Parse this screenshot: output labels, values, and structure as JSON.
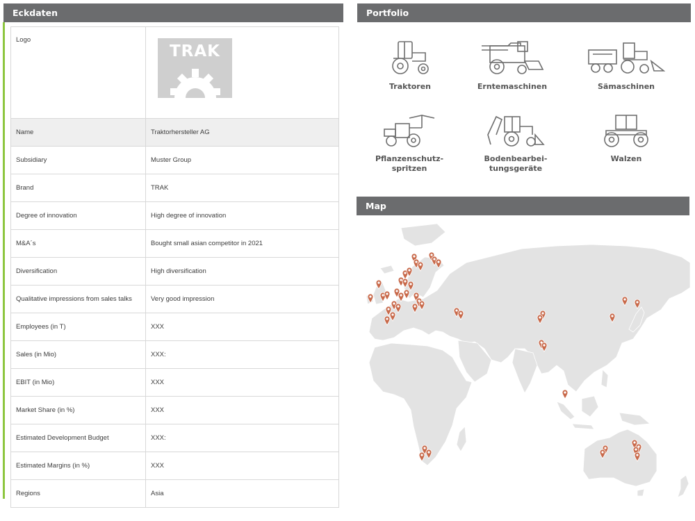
{
  "eckdaten": {
    "header": "Eckdaten",
    "logo_label": "Logo",
    "logo_text": "TRAK",
    "rows": [
      {
        "label": "Name",
        "value": "Traktorhersteller AG"
      },
      {
        "label": "Subsidiary",
        "value": "Muster Group"
      },
      {
        "label": "Brand",
        "value": "TRAK"
      },
      {
        "label": "Degree of innovation",
        "value": "High degree of innovation"
      },
      {
        "label": "M&A´s",
        "value": "Bought small asian competitor in 2021"
      },
      {
        "label": "Diversification",
        "value": "High diversification"
      },
      {
        "label": "Qualitative impressions from sales talks",
        "value": "Very good impression"
      },
      {
        "label": "Employees (in T)",
        "value": "XXX"
      },
      {
        "label": "Sales (in Mio)",
        "value": "XXX:"
      },
      {
        "label": "EBIT (in Mio)",
        "value": "XXX"
      },
      {
        "label": "Market Share (in %)",
        "value": "XXX"
      },
      {
        "label": "Estimated Development Budget",
        "value": "XXX:"
      },
      {
        "label": "Estimated Margins (in %)",
        "value": "XXX"
      },
      {
        "label": "Regions",
        "value": "Asia"
      }
    ]
  },
  "portfolio": {
    "header": "Portfolio",
    "items": [
      {
        "label": "Traktoren",
        "icon": "tractor-icon"
      },
      {
        "label": "Erntemaschinen",
        "icon": "harvester-icon"
      },
      {
        "label": "Sämaschinen",
        "icon": "seeder-icon"
      },
      {
        "label": "Pflanzenschutz-",
        "label2": "spritzen",
        "icon": "sprayer-icon"
      },
      {
        "label": "Bodenbearbei-",
        "label2": "tungsgeräte",
        "icon": "tillage-icon"
      },
      {
        "label": "Walzen",
        "icon": "roller-icon"
      }
    ]
  },
  "map": {
    "header": "Map",
    "marker_color": "#c8694a",
    "land_color": "#e3e3e3"
  }
}
